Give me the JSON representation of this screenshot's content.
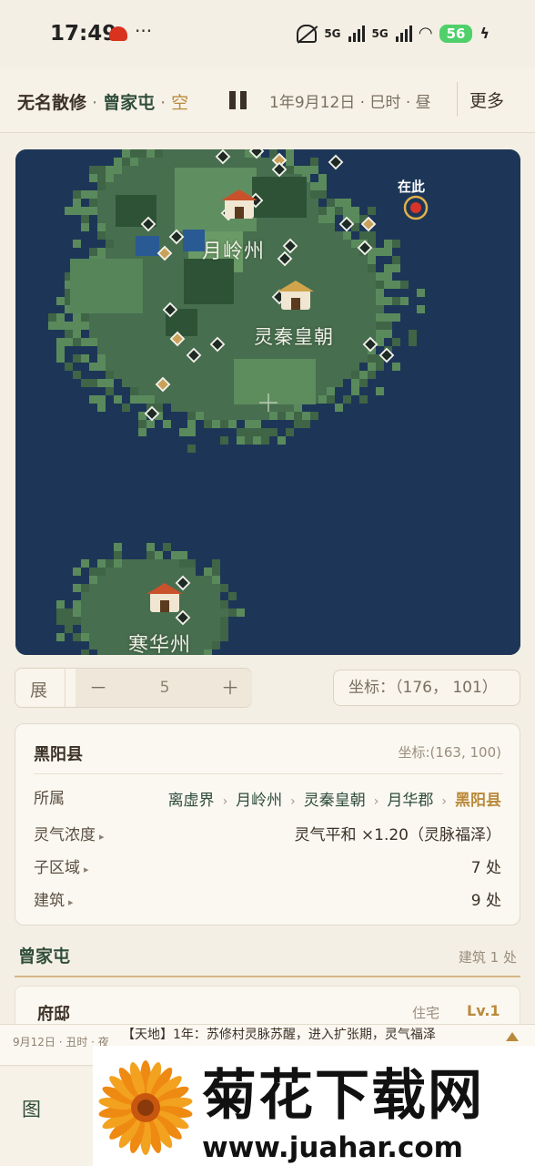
{
  "status_bar": {
    "time": "17:49",
    "network": "5G",
    "battery": "56"
  },
  "header": {
    "name": "无名散修",
    "separator": "·",
    "place": "曾家屯",
    "state": "空",
    "date": "1年9月12日 · 巳时 · 昼",
    "more": "更多"
  },
  "map": {
    "labels": {
      "region1": "月岭州",
      "region2": "灵秦皇朝",
      "region3": "寒华州"
    },
    "here": "在此",
    "colors": {
      "ocean": "#1d3657",
      "land": "#476e4e",
      "forest": "#2e5236",
      "marker": "#d8342a"
    }
  },
  "controls": {
    "zoom_label": "展",
    "minus": "－",
    "zoom_value": "5",
    "plus": "＋",
    "coord": "坐标：（176， 101）"
  },
  "info": {
    "title": "黑阳县",
    "coord": "坐标:(163, 100)",
    "belongs_label": "所属",
    "breadcrumb": [
      "离虚界",
      "月岭州",
      "灵秦皇朝",
      "月华郡"
    ],
    "breadcrumb_last": "黑阳县",
    "crumb_sep": "›",
    "qi_label": "灵气浓度",
    "qi_value": "灵气平和 ×1.20（灵脉福泽）",
    "sub_label": "子区域",
    "sub_value": "7 处",
    "bld_label": "建筑",
    "bld_value": "9 处",
    "expand_glyph": "▸"
  },
  "section": {
    "title": "曾家屯",
    "meta": "建筑 1 处",
    "buildings": [
      {
        "name": "府邸",
        "type": "住宅",
        "level": "Lv.1"
      }
    ]
  },
  "event": {
    "time": "9月12日 · 丑时 · 夜",
    "text": "【天地】1年：苏修村灵脉苏醒，进入扩张期，灵气福泽"
  },
  "nav": {
    "map": "图"
  },
  "watermark": {
    "title": "菊花下载网",
    "url": "www.juahar.com"
  }
}
